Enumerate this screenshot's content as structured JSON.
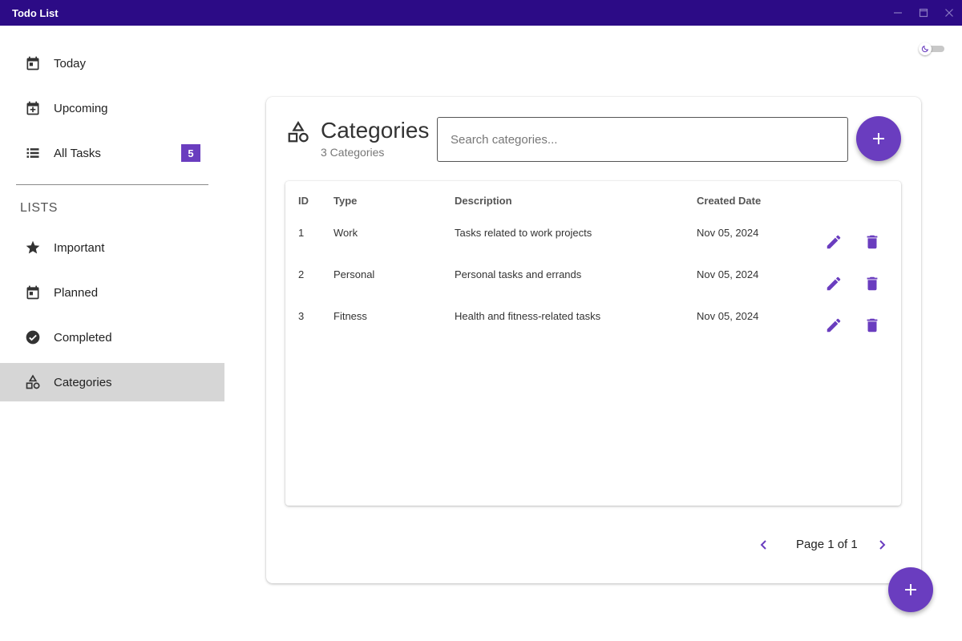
{
  "window": {
    "title": "Todo List"
  },
  "colors": {
    "titlebar": "#2c0b86",
    "accent": "#6a3dbf",
    "active_nav": "#d6d6d6"
  },
  "sidebar": {
    "items": [
      {
        "label": "Today",
        "icon": "calendar-today-icon"
      },
      {
        "label": "Upcoming",
        "icon": "calendar-plus-icon"
      },
      {
        "label": "All Tasks",
        "icon": "list-icon",
        "badge": "5"
      }
    ],
    "section_label": "LISTS",
    "lists": [
      {
        "label": "Important",
        "icon": "star-icon"
      },
      {
        "label": "Planned",
        "icon": "calendar-icon"
      },
      {
        "label": "Completed",
        "icon": "check-circle-icon"
      },
      {
        "label": "Categories",
        "icon": "shapes-icon",
        "active": true
      }
    ]
  },
  "header": {
    "title": "Categories",
    "subtitle": "3 Categories",
    "search_placeholder": "Search categories..."
  },
  "table": {
    "columns": [
      "ID",
      "Type",
      "Description",
      "Created Date"
    ],
    "rows": [
      {
        "id": "1",
        "type": "Work",
        "description": "Tasks related to work projects",
        "created": "Nov 05, 2024"
      },
      {
        "id": "2",
        "type": "Personal",
        "description": "Personal tasks and errands",
        "created": "Nov 05, 2024"
      },
      {
        "id": "3",
        "type": "Fitness",
        "description": "Health and fitness-related tasks",
        "created": "Nov 05, 2024"
      }
    ]
  },
  "pagination": {
    "label": "Page 1 of 1"
  }
}
